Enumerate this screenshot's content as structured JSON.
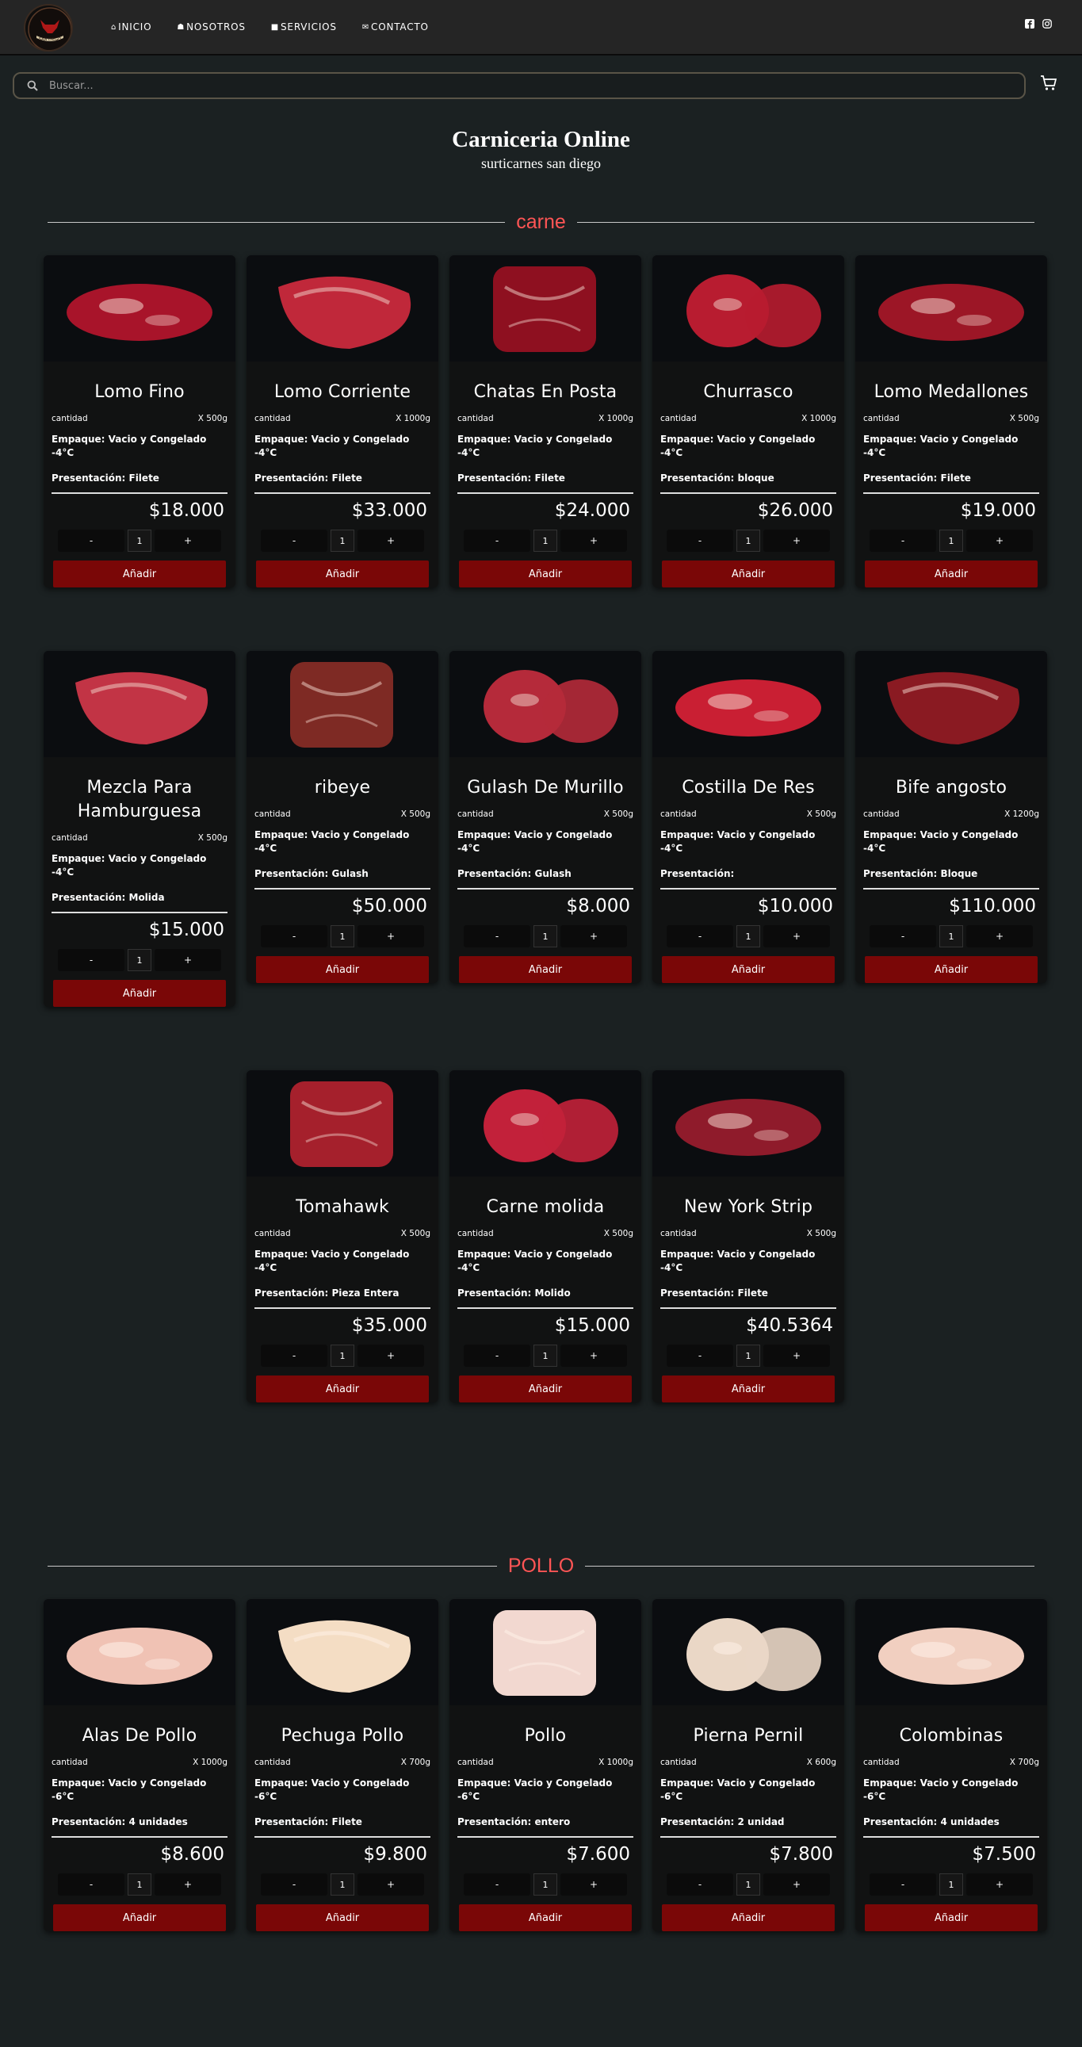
{
  "nav": {
    "links": [
      {
        "label": "INICIO",
        "icon": "home-icon"
      },
      {
        "label": "NOSOTROS",
        "icon": "users-icon"
      },
      {
        "label": "SERVICIOS",
        "icon": "truck-icon"
      },
      {
        "label": "CONTACTO",
        "icon": "envelope-icon"
      }
    ],
    "logo_text": "SAN DIEGO"
  },
  "search": {
    "placeholder": "Buscar..."
  },
  "hero": {
    "title": "Carniceria Online",
    "subtitle": "surticarnes san diego"
  },
  "common": {
    "cantidad_label": "cantidad",
    "add_label": "Añadir",
    "minus": "-",
    "plus": "+",
    "qty": "1"
  },
  "sections": [
    {
      "label": "carne",
      "products": [
        {
          "name": "Lomo Fino",
          "weight": "X 500g",
          "empaque": "Empaque: Vacio y Congelado -4°C",
          "presentacion": "Presentación: Filete",
          "price": "$18.000"
        },
        {
          "name": "Lomo Corriente",
          "weight": "X 1000g",
          "empaque": "Empaque: Vacio y Congelado -4°C",
          "presentacion": "Presentación: Filete",
          "price": "$33.000"
        },
        {
          "name": "Chatas En Posta",
          "weight": "X 1000g",
          "empaque": "Empaque: Vacio y Congelado -4°C",
          "presentacion": "Presentación: Filete",
          "price": "$24.000"
        },
        {
          "name": "Churrasco",
          "weight": "X 1000g",
          "empaque": "Empaque: Vacio y Congelado -4°C",
          "presentacion": "Presentación: bloque",
          "price": "$26.000"
        },
        {
          "name": "Lomo Medallones",
          "weight": "X 500g",
          "empaque": "Empaque: Vacio y Congelado -4°C",
          "presentacion": "Presentación: Filete",
          "price": "$19.000"
        },
        {
          "name": "Mezcla Para Hamburguesa",
          "weight": "X 500g",
          "empaque": "Empaque: Vacio y Congelado -4°C",
          "presentacion": "Presentación: Molida",
          "price": "$15.000"
        },
        {
          "name": "ribeye",
          "weight": "X 500g",
          "empaque": "Empaque: Vacio y Congelado -4°C",
          "presentacion": "Presentación: Gulash",
          "price": "$50.000"
        },
        {
          "name": "Gulash De Murillo",
          "weight": "X 500g",
          "empaque": "Empaque: Vacio y Congelado -4°C",
          "presentacion": "Presentación: Gulash",
          "price": "$8.000"
        },
        {
          "name": "Costilla De Res",
          "weight": "X 500g",
          "empaque": "Empaque: Vacio y Congelado -4°C",
          "presentacion": "Presentación:",
          "price": "$10.000"
        },
        {
          "name": "Bife angosto",
          "weight": "X 1200g",
          "empaque": "Empaque: Vacio y Congelado -4°C",
          "presentacion": "Presentación: Bloque",
          "price": "$110.000"
        },
        {
          "name": "Tomahawk",
          "weight": "X 500g",
          "empaque": "Empaque: Vacio y Congelado -4°C",
          "presentacion": "Presentación: Pieza Entera",
          "price": "$35.000"
        },
        {
          "name": "Carne molida",
          "weight": "X 500g",
          "empaque": "Empaque: Vacio y Congelado -4°C",
          "presentacion": "Presentación: Molido",
          "price": "$15.000"
        },
        {
          "name": "New York Strip",
          "weight": "X 500g",
          "empaque": "Empaque: Vacio y Congelado -4°C",
          "presentacion": "Presentación: Filete",
          "price": "$40.5364"
        }
      ]
    },
    {
      "label": "POLLO",
      "products": [
        {
          "name": "Alas De Pollo",
          "weight": "X 1000g",
          "empaque": "Empaque: Vacio y Congelado -6°C",
          "presentacion": "Presentación: 4 unidades",
          "price": "$8.600"
        },
        {
          "name": "Pechuga Pollo",
          "weight": "X 700g",
          "empaque": "Empaque: Vacio y Congelado -6°C",
          "presentacion": "Presentación: Filete",
          "price": "$9.800"
        },
        {
          "name": "Pollo",
          "weight": "X 1000g",
          "empaque": "Empaque: Vacio y Congelado -6°C",
          "presentacion": "Presentación: entero",
          "price": "$7.600"
        },
        {
          "name": "Pierna Pernil",
          "weight": "X 600g",
          "empaque": "Empaque: Vacio y Congelado -6°C",
          "presentacion": "Presentación: 2 unidad",
          "price": "$7.800"
        },
        {
          "name": "Colombinas",
          "weight": "X 700g",
          "empaque": "Empaque: Vacio y Congelado -6°C",
          "presentacion": "Presentación: 4 unidades",
          "price": "$7.500"
        }
      ]
    }
  ],
  "colors": {
    "accent": "#ff5555",
    "add_button": "#7a0707",
    "background": "#1b2122",
    "card": "#111212"
  }
}
